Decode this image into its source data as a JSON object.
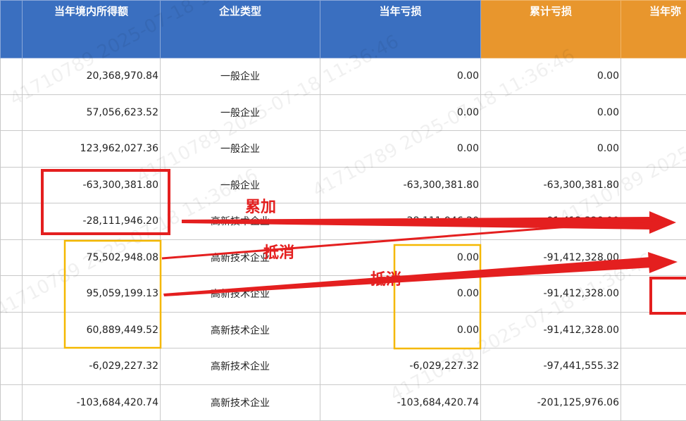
{
  "table": {
    "columns": [
      "",
      "当年境内所得额",
      "企业类型",
      "当年亏损",
      "累计亏损",
      "当年弥"
    ],
    "rows": [
      {
        "income": "20,368,970.84",
        "type": "一般企业",
        "loss": "0.00",
        "cum": "0.00"
      },
      {
        "income": "57,056,623.52",
        "type": "一般企业",
        "loss": "0.00",
        "cum": "0.00"
      },
      {
        "income": "123,962,027.36",
        "type": "一般企业",
        "loss": "0.00",
        "cum": "0.00"
      },
      {
        "income": "-63,300,381.80",
        "type": "一般企业",
        "loss": "-63,300,381.80",
        "cum": "-63,300,381.80"
      },
      {
        "income": "-28,111,946.20",
        "type": "高新技术企业",
        "loss": "-28,111,946.20",
        "cum": "-91,412,328.00"
      },
      {
        "income": "75,502,948.08",
        "type": "高新技术企业",
        "loss": "0.00",
        "cum": "-91,412,328.00"
      },
      {
        "income": "95,059,199.13",
        "type": "高新技术企业",
        "loss": "0.00",
        "cum": "-91,412,328.00"
      },
      {
        "income": "60,889,449.52",
        "type": "高新技术企业",
        "loss": "0.00",
        "cum": "-91,412,328.00"
      },
      {
        "income": "-6,029,227.32",
        "type": "高新技术企业",
        "loss": "-6,029,227.32",
        "cum": "-97,441,555.32"
      },
      {
        "income": "-103,684,420.74",
        "type": "高新技术企业",
        "loss": "-103,684,420.74",
        "cum": "-201,125,976.06"
      }
    ]
  },
  "annotations": {
    "label_accumulate": "累加",
    "label_offset_1": "抵消",
    "label_offset_2": "抵消"
  },
  "watermark": "41710789 2025-07-18 11:36:46",
  "colors": {
    "header_blue": "#3a6fc0",
    "header_orange": "#e8962d",
    "annotation_red": "#e41f1f",
    "highlight_yellow": "#f5b800"
  }
}
